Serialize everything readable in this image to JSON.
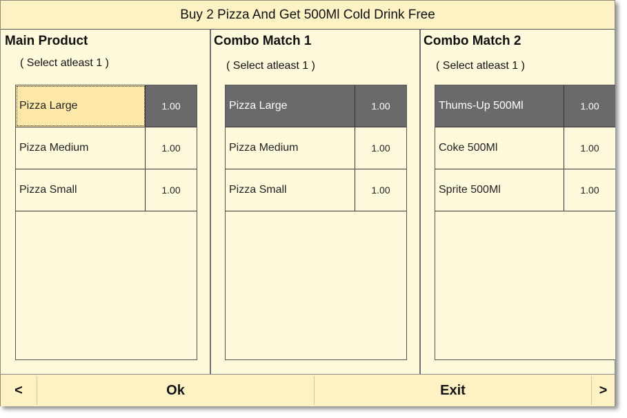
{
  "window": {
    "title": "Buy 2 Pizza And Get 500Ml Cold Drink Free"
  },
  "panels": [
    {
      "title": "Main Product",
      "hint": "( Select atleast 1 )",
      "items": [
        {
          "name": "Pizza Large",
          "qty": "1.00",
          "state": "focused"
        },
        {
          "name": "Pizza Medium",
          "qty": "1.00",
          "state": "normal"
        },
        {
          "name": "Pizza Small",
          "qty": "1.00",
          "state": "normal"
        }
      ]
    },
    {
      "title": "Combo Match 1",
      "hint": "( Select atleast 1 )",
      "items": [
        {
          "name": "Pizza Large",
          "qty": "1.00",
          "state": "selected"
        },
        {
          "name": "Pizza Medium",
          "qty": "1.00",
          "state": "normal"
        },
        {
          "name": "Pizza Small",
          "qty": "1.00",
          "state": "normal"
        }
      ]
    },
    {
      "title": "Combo Match 2",
      "hint": "( Select atleast 1 )",
      "items": [
        {
          "name": "Thums-Up 500Ml",
          "qty": "1.00",
          "state": "selected"
        },
        {
          "name": "Coke 500Ml",
          "qty": "1.00",
          "state": "normal"
        },
        {
          "name": "Sprite 500Ml",
          "qty": "1.00",
          "state": "normal"
        }
      ]
    }
  ],
  "footer": {
    "prev_label": "<",
    "ok_label": "Ok",
    "exit_label": "Exit",
    "next_label": ">"
  },
  "colors": {
    "background": "#fffadc",
    "title_bar": "#fdf2c4",
    "selected_row": "#6a6a6a",
    "focused_row": "#fde8a8"
  }
}
